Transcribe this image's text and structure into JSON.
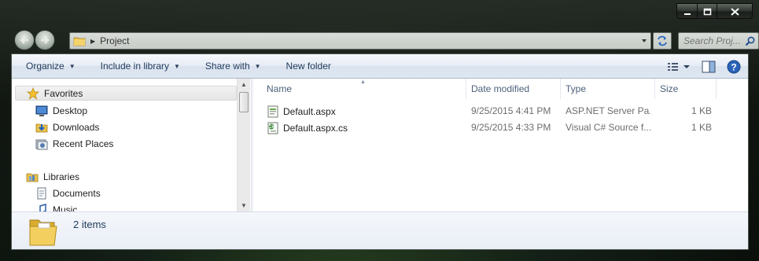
{
  "window": {
    "caption_buttons": [
      "minimize",
      "maximize",
      "close"
    ]
  },
  "address_bar": {
    "path": [
      "Project"
    ]
  },
  "search": {
    "placeholder": "Search Proj..."
  },
  "command_bar": {
    "organize": "Organize",
    "include_in_library": "Include in library",
    "share_with": "Share with",
    "new_folder": "New folder"
  },
  "nav_pane": {
    "items": [
      {
        "label": "Favorites",
        "icon": "star-icon"
      },
      {
        "label": "Desktop",
        "icon": "desktop-icon"
      },
      {
        "label": "Downloads",
        "icon": "downloads-icon"
      },
      {
        "label": "Recent Places",
        "icon": "recent-places-icon"
      },
      {
        "label": "Libraries",
        "icon": "libraries-icon"
      },
      {
        "label": "Documents",
        "icon": "documents-icon"
      },
      {
        "label": "Music",
        "icon": "music-icon"
      }
    ]
  },
  "file_list": {
    "columns": {
      "name": "Name",
      "date": "Date modified",
      "type": "Type",
      "size": "Size"
    },
    "rows": [
      {
        "name": "Default.aspx",
        "date": "9/25/2015 4:41 PM",
        "type": "ASP.NET Server Pa...",
        "size": "1 KB",
        "icon": "aspx-file-icon"
      },
      {
        "name": "Default.aspx.cs",
        "date": "9/25/2015 4:33 PM",
        "type": "Visual C# Source f...",
        "size": "1 KB",
        "icon": "csharp-file-icon"
      }
    ]
  },
  "details_pane": {
    "item_count": "2 items"
  },
  "colors": {
    "accent_text": "#1e395b",
    "command_bar_bg": "#dfe7f2",
    "folder_yellow": "#e8c14a"
  }
}
